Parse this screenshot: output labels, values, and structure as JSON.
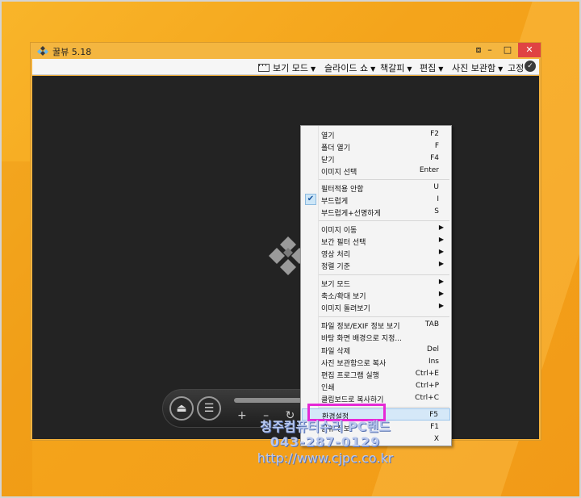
{
  "window": {
    "title": "꿀뷰 5.18",
    "controls": {
      "minimize": "–",
      "maximize": "□",
      "close": "✕",
      "tile": "⧈"
    }
  },
  "menubar": {
    "items": [
      {
        "label": "보기 모드"
      },
      {
        "label": "슬라이드 쇼"
      },
      {
        "label": "책갈피"
      },
      {
        "label": "편집"
      },
      {
        "label": "사진 보관함"
      },
      {
        "label": "고정"
      }
    ]
  },
  "toolbar": {
    "zoom_symbols": "+ – ↻ ↺"
  },
  "context_menu": {
    "items": [
      {
        "label": "열기",
        "shortcut": "F2"
      },
      {
        "label": "폴더 열기",
        "shortcut": "F"
      },
      {
        "label": "닫기",
        "shortcut": "F4"
      },
      {
        "label": "이미지 선택",
        "shortcut": "Enter"
      },
      {
        "label": "필터적용 안함",
        "shortcut": "U"
      },
      {
        "label": "부드럽게",
        "shortcut": "I",
        "checked": true
      },
      {
        "label": "부드럽게+선명하게",
        "shortcut": "S"
      },
      {
        "label": "이미지 이동",
        "submenu": true
      },
      {
        "label": "보간 필터 선택",
        "submenu": true
      },
      {
        "label": "영상 처리",
        "submenu": true
      },
      {
        "label": "정렬 기준",
        "submenu": true
      },
      {
        "label": "보기 모드",
        "submenu": true
      },
      {
        "label": "축소/확대 보기",
        "submenu": true
      },
      {
        "label": "이미지 돌려보기",
        "submenu": true
      },
      {
        "label": "파일 정보/EXIF 정보 보기",
        "shortcut": "TAB"
      },
      {
        "label": "바탕 화면 배경으로 지정...",
        "shortcut": ""
      },
      {
        "label": "파일 삭제",
        "shortcut": "Del"
      },
      {
        "label": "사진 보관함으로 복사",
        "shortcut": "Ins"
      },
      {
        "label": "편집 프로그램 실행",
        "shortcut": "Ctrl+E"
      },
      {
        "label": "인쇄",
        "shortcut": "Ctrl+P"
      },
      {
        "label": "클립보드로 복사하기",
        "shortcut": "Ctrl+C"
      },
      {
        "label": "환경설정",
        "shortcut": "F5",
        "highlighted": true
      },
      {
        "label": "꿀뷰 정보",
        "shortcut": "F1"
      },
      {
        "label": "",
        "shortcut": "X"
      }
    ]
  },
  "watermark": {
    "line1": "청주컴퓨터수리 PC랜드",
    "line2": "043-287-0129",
    "line3": "http://www.cjpc.co.kr"
  },
  "colors": {
    "desktop": "#f4a41b",
    "viewer_bg": "#232323",
    "highlight_box": "#e629d6",
    "close_button": "#e04343"
  }
}
